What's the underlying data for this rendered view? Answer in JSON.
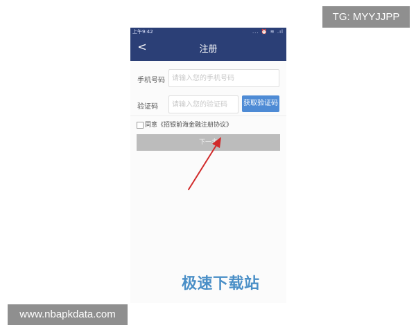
{
  "overlay": {
    "top_watermark": "TG: MYYJJPP",
    "bottom_watermark": "www.nbapkdata.com"
  },
  "status_bar": {
    "time": "上午9:42",
    "icons": "... ⏰ ≋ .ıl"
  },
  "header": {
    "back_icon": "<",
    "title": "注册"
  },
  "form": {
    "phone_label": "手机号码",
    "phone_placeholder": "请输入您的手机号码",
    "code_label": "验证码",
    "code_placeholder": "请输入您的验证码",
    "get_code_button": "获取验证码",
    "agreement_prefix": "同意",
    "agreement_link": "《招银前海金融注册协议》",
    "next_button": "下一步"
  },
  "brand": {
    "watermark": "极速下载站"
  },
  "colors": {
    "header_bg": "#2b3f76",
    "button_blue": "#4e8bd5",
    "disabled_gray": "#bcbcbc",
    "arrow_red": "#d12a2a",
    "brand_blue": "#4a8fc7"
  },
  "icons": {
    "back": "chevron-left-icon",
    "checkbox": "checkbox-icon",
    "arrow": "red-arrow-icon"
  }
}
